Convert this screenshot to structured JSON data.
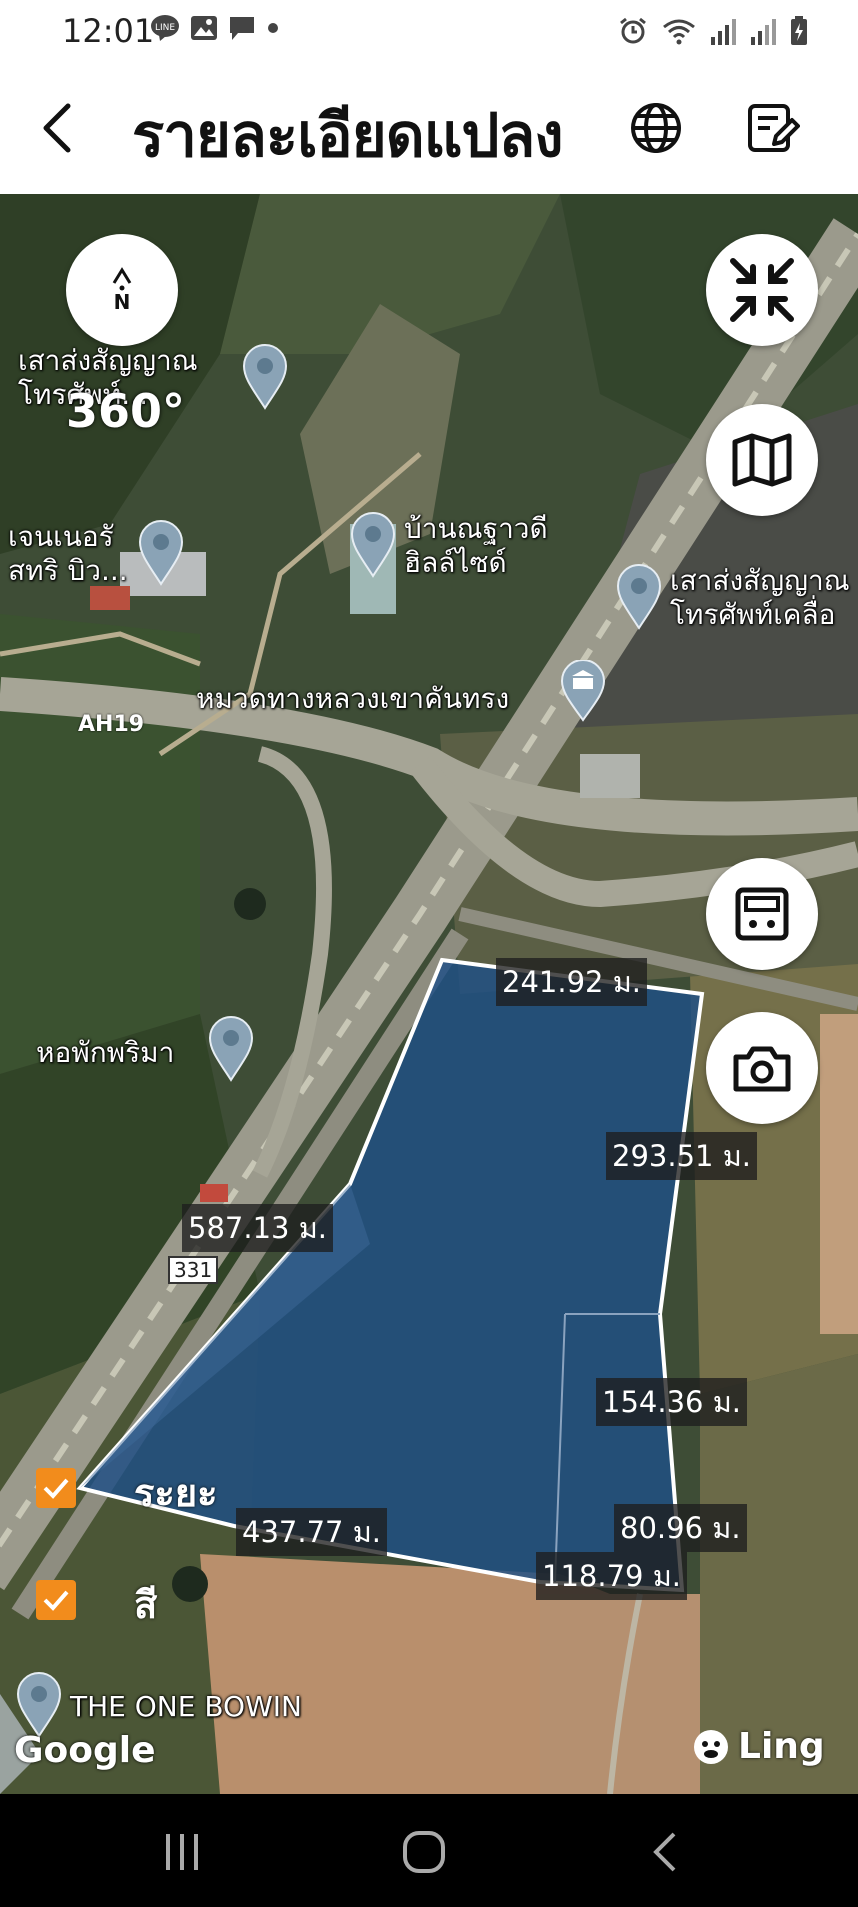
{
  "status_bar": {
    "time": "12:01"
  },
  "header": {
    "title": "รายละเอียดแปลง"
  },
  "map": {
    "compass": {
      "letter": "N",
      "label": "360°"
    },
    "pois": [
      {
        "id": "tower1",
        "label": "เสาส่งสัญญาณ\nโทรศัพท์..."
      },
      {
        "id": "general",
        "label": "เจนเนอรั\nสทริ บิว..."
      },
      {
        "id": "village",
        "label": "บ้านณฐาวดี\nฮิลล์ไซด์"
      },
      {
        "id": "tower2",
        "label": "เสาส่งสัญญาณ\nโทรศัพท์เคลื่อ"
      },
      {
        "id": "highway",
        "label": "หมวดทางหลวงเขาคันทรง"
      },
      {
        "id": "dorm",
        "label": "หอพักพริมา"
      },
      {
        "id": "oneb",
        "label": "THE ONE BOWIN"
      }
    ],
    "road_labels": {
      "ah": "AH19",
      "route": "331"
    },
    "distances": {
      "top": "241.92 ม.",
      "right_upper": "293.51 ม.",
      "left": "587.13 ม.",
      "right_mid": "154.36 ม.",
      "bottom_left": "437.77 ม.",
      "right_lower": "80.96 ม.",
      "bottom_right": "118.79 ม."
    },
    "toggles": [
      {
        "label": "ระยะ",
        "checked": true
      },
      {
        "label": "สี",
        "checked": true
      }
    ],
    "attribution": "Google",
    "watermark": "Ling",
    "parcel_color": "#1f4f86"
  }
}
